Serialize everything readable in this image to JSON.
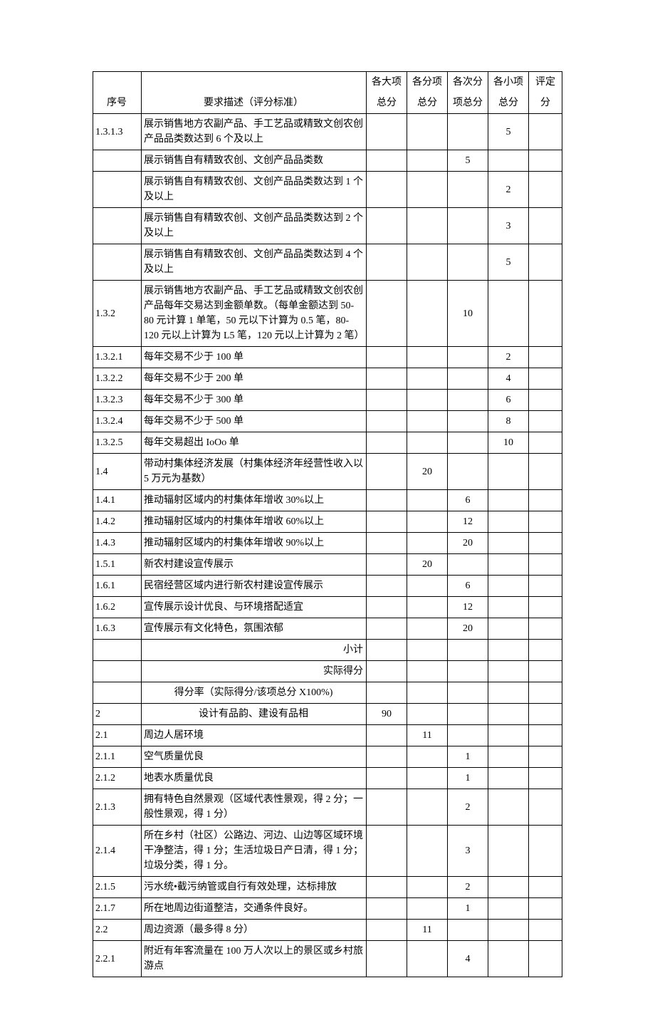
{
  "headers": {
    "seq": "序号",
    "desc": "要求描述（评分标准）",
    "c1a": "各大项",
    "c1b": "总分",
    "c2a": "各分项",
    "c2b": "总分",
    "c3a": "各次分",
    "c3b": "项总分",
    "c4a": "各小项",
    "c4b": "总分",
    "c5a": "评定",
    "c5b": "分"
  },
  "rows": [
    {
      "seq": "1.3.1.3",
      "desc": "展示销售地方农副产品、手工艺品或精致文创农创产品品类数达到 6 个及以上",
      "c1": "",
      "c2": "",
      "c3": "",
      "c4": "5",
      "c5": ""
    },
    {
      "seq": "",
      "desc": "展示销售自有精致农创、文创产品品类数",
      "c1": "",
      "c2": "",
      "c3": "5",
      "c4": "",
      "c5": ""
    },
    {
      "seq": "",
      "desc": "展示销售自有精致农创、文创产品品类数达到 1 个及以上",
      "c1": "",
      "c2": "",
      "c3": "",
      "c4": "2",
      "c5": ""
    },
    {
      "seq": "",
      "desc": "展示销售自有精致农创、文创产品品类数达到 2 个及以上",
      "c1": "",
      "c2": "",
      "c3": "",
      "c4": "3",
      "c5": ""
    },
    {
      "seq": "",
      "desc": "展示销售自有精致农创、文创产品品类数达到 4 个及以上",
      "c1": "",
      "c2": "",
      "c3": "",
      "c4": "5",
      "c5": ""
    },
    {
      "seq": "1.3.2",
      "desc": "展示销售地方农副产品、手工艺品或精致文创农创产品每年交易达到金额单数。（每单金额达到 50-80 元计算 1 单笔，50 元以下计算为 0.5 笔，80-120 元以上计算为 L5 笔，120 元以上计算为 2 笔）",
      "c1": "",
      "c2": "",
      "c3": "10",
      "c4": "",
      "c5": ""
    },
    {
      "seq": "1.3.2.1",
      "desc": "每年交易不少于 100 单",
      "c1": "",
      "c2": "",
      "c3": "",
      "c4": "2",
      "c5": ""
    },
    {
      "seq": "1.3.2.2",
      "desc": "每年交易不少于 200 单",
      "c1": "",
      "c2": "",
      "c3": "",
      "c4": "4",
      "c5": ""
    },
    {
      "seq": "1.3.2.3",
      "desc": "每年交易不少于 300 单",
      "c1": "",
      "c2": "",
      "c3": "",
      "c4": "6",
      "c5": ""
    },
    {
      "seq": "1.3.2.4",
      "desc": "每年交易不少于 500 单",
      "c1": "",
      "c2": "",
      "c3": "",
      "c4": "8",
      "c5": ""
    },
    {
      "seq": "1.3.2.5",
      "desc": "每年交易超出 IoOo 单",
      "c1": "",
      "c2": "",
      "c3": "",
      "c4": "10",
      "c5": ""
    },
    {
      "seq": "1.4",
      "desc": "带动村集体经济发展（村集体经济年经营性收入以 5 万元为基数）",
      "c1": "",
      "c2": "20",
      "c3": "",
      "c4": "",
      "c5": ""
    },
    {
      "seq": "1.4.1",
      "desc": "推动辐射区域内的村集体年增收 30%以上",
      "c1": "",
      "c2": "",
      "c3": "6",
      "c4": "",
      "c5": ""
    },
    {
      "seq": "1.4.2",
      "desc": "推动辐射区域内的村集体年增收 60%以上",
      "c1": "",
      "c2": "",
      "c3": "12",
      "c4": "",
      "c5": ""
    },
    {
      "seq": "1.4.3",
      "desc": "推动辐射区域内的村集体年增收 90%以上",
      "c1": "",
      "c2": "",
      "c3": "20",
      "c4": "",
      "c5": ""
    },
    {
      "seq": "1.5.1",
      "desc": "新农村建设宣传展示",
      "c1": "",
      "c2": "20",
      "c3": "",
      "c4": "",
      "c5": ""
    },
    {
      "seq": "1.6.1",
      "desc": "民宿经营区域内进行新农村建设宣传展示",
      "c1": "",
      "c2": "",
      "c3": "6",
      "c4": "",
      "c5": ""
    },
    {
      "seq": "1.6.2",
      "desc": "宣传展示设计优良、与环境搭配适宜",
      "c1": "",
      "c2": "",
      "c3": "12",
      "c4": "",
      "c5": ""
    },
    {
      "seq": "1.6.3",
      "desc": "宣传展示有文化特色，氛围浓郁",
      "c1": "",
      "c2": "",
      "c3": "20",
      "c4": "",
      "c5": ""
    },
    {
      "seq": "",
      "desc": "小计",
      "descAlign": "right",
      "c1": "",
      "c2": "",
      "c3": "",
      "c4": "",
      "c5": ""
    },
    {
      "seq": "",
      "desc": "实际得分",
      "descAlign": "right",
      "c1": "",
      "c2": "",
      "c3": "",
      "c4": "",
      "c5": ""
    },
    {
      "seq": "",
      "desc": "得分率（实际得分/该项总分 X100%)",
      "descAlign": "center",
      "c1": "",
      "c2": "",
      "c3": "",
      "c4": "",
      "c5": ""
    },
    {
      "seq": "2",
      "desc": "设计有品韵、建设有品相",
      "descAlign": "center",
      "c1": "90",
      "c2": "",
      "c3": "",
      "c4": "",
      "c5": ""
    },
    {
      "seq": "2.1",
      "desc": "周边人居环境",
      "c1": "",
      "c2": "11",
      "c3": "",
      "c4": "",
      "c5": ""
    },
    {
      "seq": "2.1.1",
      "desc": "空气质量优良",
      "c1": "",
      "c2": "",
      "c3": "1",
      "c4": "",
      "c5": ""
    },
    {
      "seq": "2.1.2",
      "desc": "地表水质量优良",
      "c1": "",
      "c2": "",
      "c3": "1",
      "c4": "",
      "c5": ""
    },
    {
      "seq": "2.1.3",
      "desc": "拥有特色自然景观（区域代表性景观，得 2 分；一般性景观，得 1 分）",
      "c1": "",
      "c2": "",
      "c3": "2",
      "c4": "",
      "c5": ""
    },
    {
      "seq": "2.1.4",
      "desc": "所在乡村（社区）公路边、河边、山边等区域环境干净整洁，得 1 分；生活垃圾日产日清，得 1 分；垃圾分类，得 1 分。",
      "c1": "",
      "c2": "",
      "c3": "3",
      "c4": "",
      "c5": ""
    },
    {
      "seq": "2.1.5",
      "desc": "污水统•截污纳管或自行有效处理，达标排放",
      "c1": "",
      "c2": "",
      "c3": "2",
      "c4": "",
      "c5": ""
    },
    {
      "seq": "2.1.7",
      "desc": "所在地周边街道整洁，交通条件良好。",
      "c1": "",
      "c2": "",
      "c3": "1",
      "c4": "",
      "c5": ""
    },
    {
      "seq": "2.2",
      "desc": "周边资源（最多得 8 分）",
      "c1": "",
      "c2": "11",
      "c3": "",
      "c4": "",
      "c5": ""
    },
    {
      "seq": "2.2.1",
      "desc": "附近有年客流量在 100 万人次以上的景区或乡村旅游点",
      "c1": "",
      "c2": "",
      "c3": "4",
      "c4": "",
      "c5": ""
    }
  ]
}
